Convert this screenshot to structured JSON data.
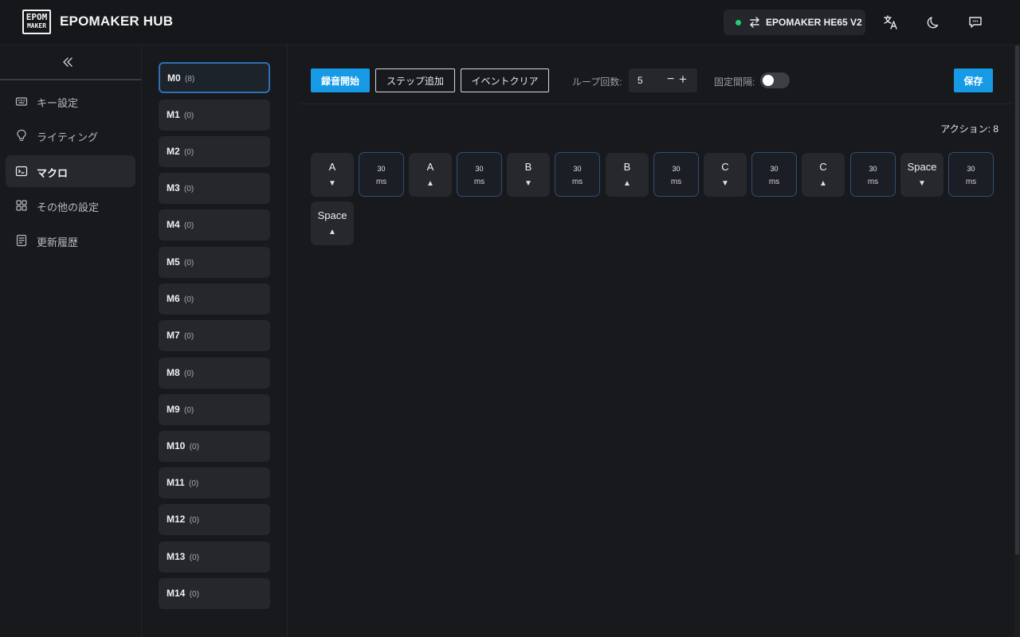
{
  "header": {
    "logo_top": "EPOM",
    "logo_bottom": "MAKER",
    "app_title": "EPOMAKER HUB",
    "device_name": "EPOMAKER HE65 V2",
    "device_status_color": "#1ed36c"
  },
  "sidebar": {
    "items": [
      {
        "label": "キー設定",
        "icon": "keyboard-icon",
        "active": false
      },
      {
        "label": "ライティング",
        "icon": "bulb-icon",
        "active": false
      },
      {
        "label": "マクロ",
        "icon": "terminal-icon",
        "active": true
      },
      {
        "label": "その他の設定",
        "icon": "grid-icon",
        "active": false
      },
      {
        "label": "更新履歴",
        "icon": "document-icon",
        "active": false
      }
    ]
  },
  "macros": [
    {
      "name": "M0",
      "count": "(8)"
    },
    {
      "name": "M1",
      "count": "(0)"
    },
    {
      "name": "M2",
      "count": "(0)"
    },
    {
      "name": "M3",
      "count": "(0)"
    },
    {
      "name": "M4",
      "count": "(0)"
    },
    {
      "name": "M5",
      "count": "(0)"
    },
    {
      "name": "M6",
      "count": "(0)"
    },
    {
      "name": "M7",
      "count": "(0)"
    },
    {
      "name": "M8",
      "count": "(0)"
    },
    {
      "name": "M9",
      "count": "(0)"
    },
    {
      "name": "M10",
      "count": "(0)"
    },
    {
      "name": "M11",
      "count": "(0)"
    },
    {
      "name": "M12",
      "count": "(0)"
    },
    {
      "name": "M13",
      "count": "(0)"
    },
    {
      "name": "M14",
      "count": "(0)"
    }
  ],
  "toolbar": {
    "record_label": "録音開始",
    "add_step_label": "ステップ追加",
    "clear_events_label": "イベントクリア",
    "loop_label": "ループ回数:",
    "loop_value": "5",
    "minus": "−",
    "plus": "+",
    "fixed_interval_label": "固定間隔:",
    "fixed_interval_on": false,
    "save_label": "保存",
    "accent_color": "#169ae6"
  },
  "action_count_label": "アクション: 8",
  "events": [
    {
      "type": "key",
      "label": "A",
      "arrow": "▼"
    },
    {
      "type": "delay",
      "value": "30",
      "unit": "ms"
    },
    {
      "type": "key",
      "label": "A",
      "arrow": "▲"
    },
    {
      "type": "delay",
      "value": "30",
      "unit": "ms"
    },
    {
      "type": "key",
      "label": "B",
      "arrow": "▼"
    },
    {
      "type": "delay",
      "value": "30",
      "unit": "ms"
    },
    {
      "type": "key",
      "label": "B",
      "arrow": "▲"
    },
    {
      "type": "delay",
      "value": "30",
      "unit": "ms"
    },
    {
      "type": "key",
      "label": "C",
      "arrow": "▼"
    },
    {
      "type": "delay",
      "value": "30",
      "unit": "ms"
    },
    {
      "type": "key",
      "label": "C",
      "arrow": "▲"
    },
    {
      "type": "delay",
      "value": "30",
      "unit": "ms"
    },
    {
      "type": "key",
      "label": "Space",
      "arrow": "▼"
    },
    {
      "type": "delay",
      "value": "30",
      "unit": "ms"
    },
    {
      "type": "key",
      "label": "Space",
      "arrow": "▲"
    }
  ]
}
